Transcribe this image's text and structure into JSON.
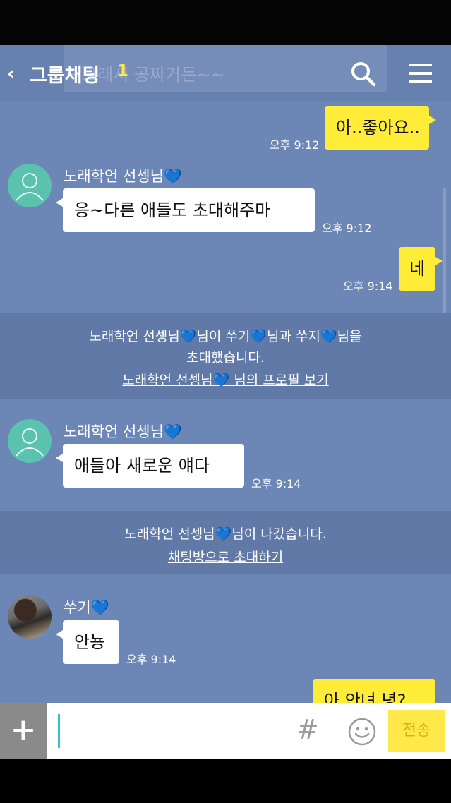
{
  "header": {
    "title": "그룹채팅",
    "member_count": "1",
    "ghost_text": "~그래서 공짜거든~~"
  },
  "messages": [
    {
      "text": "아..좋아요..",
      "time": "오후 9:12"
    },
    {
      "sender": "노래학언 선셍님💙",
      "text": "응~다른 애들도 초대해주마",
      "time": "오후 9:12"
    },
    {
      "text": "네",
      "time": "오후 9:14"
    },
    {
      "sender": "노래학언 선셍님💙",
      "text": "애들아 새로운 얘다",
      "time": "오후 9:14"
    },
    {
      "sender": "쑤기💙",
      "text": "안뇽",
      "time": "오후 9:14"
    },
    {
      "text": "아 안녀 녕?"
    }
  ],
  "system_notices": [
    {
      "line1": "노래학언 선셍님💙님이 쑤기💙님과 쑤지💙님을",
      "line2": "초대했습니다.",
      "link": "노래학언 선셍님💙 님의 프로필 보기"
    },
    {
      "line1": "노래학언 선셍님💙님이 나갔습니다.",
      "link": "채팅방으로 초대하기"
    }
  ],
  "input": {
    "plus_label": "+",
    "hash_label": "#",
    "send_label": "전송"
  },
  "colors": {
    "chat_background": "#6c87b5",
    "my_bubble": "#ffec38",
    "their_bubble": "#ffffff",
    "accent": "#39c0c4"
  },
  "icons": [
    "back-arrow-icon",
    "search-icon",
    "menu-icon",
    "person-icon",
    "emoji-icon"
  ]
}
